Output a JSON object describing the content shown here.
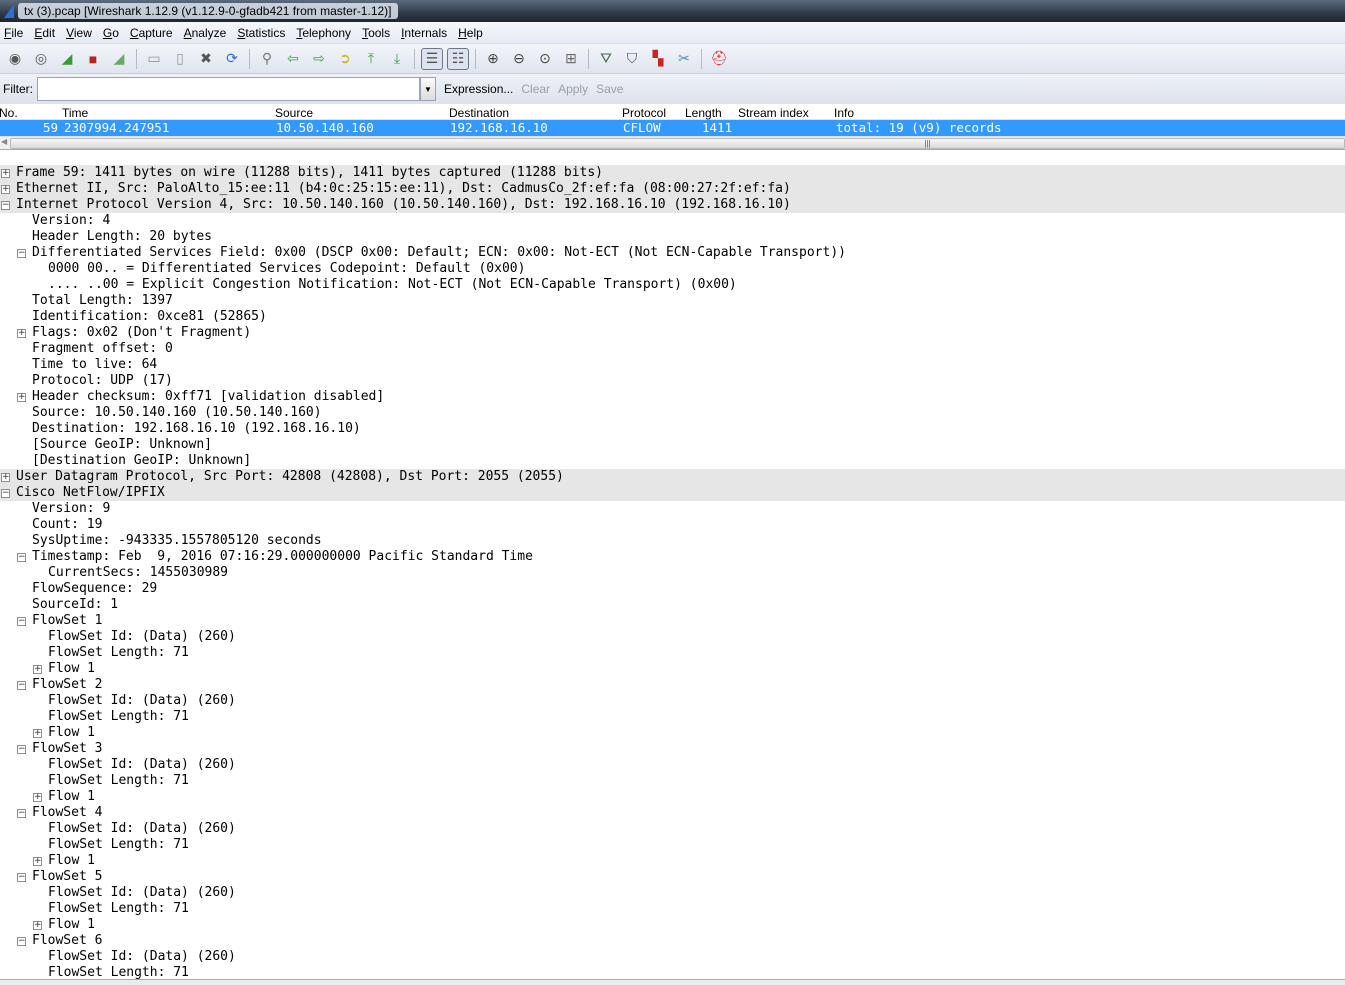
{
  "window": {
    "title": "tx (3).pcap   [Wireshark 1.12.9  (v1.12.9-0-gfadb421 from master-1.12)]"
  },
  "menu": [
    "File",
    "Edit",
    "View",
    "Go",
    "Capture",
    "Analyze",
    "Statistics",
    "Telephony",
    "Tools",
    "Internals",
    "Help"
  ],
  "toolbar": [
    {
      "name": "interfaces-icon",
      "g": "◉",
      "c": "#555"
    },
    {
      "name": "capture-options-icon",
      "g": "◎",
      "c": "#555"
    },
    {
      "name": "start-capture-icon",
      "g": "◢",
      "c": "#3a9a3a"
    },
    {
      "name": "stop-capture-icon",
      "g": "■",
      "c": "#b22"
    },
    {
      "name": "restart-capture-icon",
      "g": "◢",
      "c": "#6a6"
    },
    {
      "sep": true
    },
    {
      "name": "open-file-icon",
      "g": "▭",
      "c": "#997"
    },
    {
      "name": "save-file-icon",
      "g": "▯",
      "c": "#999"
    },
    {
      "name": "close-file-icon",
      "g": "✖",
      "c": "#555"
    },
    {
      "name": "reload-icon",
      "g": "⟳",
      "c": "#2a6fd6"
    },
    {
      "sep": true
    },
    {
      "name": "find-packet-icon",
      "g": "⚲",
      "c": "#777"
    },
    {
      "name": "go-back-icon",
      "g": "⇦",
      "c": "#3a3"
    },
    {
      "name": "go-forward-icon",
      "g": "⇨",
      "c": "#3a3"
    },
    {
      "name": "go-to-packet-icon",
      "g": "➲",
      "c": "#cb2"
    },
    {
      "name": "first-packet-icon",
      "g": "⤒",
      "c": "#3a3"
    },
    {
      "name": "last-packet-icon",
      "g": "⤓",
      "c": "#3a3"
    },
    {
      "sep": true
    },
    {
      "name": "colorize-icon",
      "g": "☰",
      "c": "#555",
      "p": true
    },
    {
      "name": "auto-scroll-icon",
      "g": "☷",
      "c": "#555",
      "p": true
    },
    {
      "sep": true
    },
    {
      "name": "zoom-in-icon",
      "g": "⊕",
      "c": "#444"
    },
    {
      "name": "zoom-out-icon",
      "g": "⊖",
      "c": "#444"
    },
    {
      "name": "zoom-normal-icon",
      "g": "⊙",
      "c": "#444"
    },
    {
      "name": "resize-columns-icon",
      "g": "⊞",
      "c": "#666"
    },
    {
      "sep": true
    },
    {
      "name": "capture-filters-icon",
      "g": "⛛",
      "c": "#464"
    },
    {
      "name": "display-filters-icon",
      "g": "⛉",
      "c": "#555"
    },
    {
      "name": "coloring-rules-icon",
      "g": "▚",
      "c": "#c22"
    },
    {
      "name": "preferences-icon",
      "g": "✂",
      "c": "#58a"
    },
    {
      "sep": true
    },
    {
      "name": "help-icon",
      "g": "⛑",
      "c": "#d33"
    }
  ],
  "filter": {
    "label": "Filter:",
    "value": "",
    "expression": "Expression...",
    "clear": "Clear",
    "apply": "Apply",
    "save": "Save"
  },
  "packet_list": {
    "columns": [
      "No.",
      "Time",
      "Source",
      "Destination",
      "Protocol",
      "Length",
      "Stream index",
      "Info"
    ],
    "rows": [
      {
        "no": "59",
        "time": "2307994.247951",
        "source": "10.50.140.160",
        "destination": "192.168.16.10",
        "protocol": "CFLOW",
        "length": "1411",
        "stream_index": "",
        "info": "total: 19 (v9) records"
      }
    ]
  },
  "details": [
    {
      "l": 0,
      "t": "+",
      "top": true,
      "s": "Frame 59: 1411 bytes on wire (11288 bits), 1411 bytes captured (11288 bits)"
    },
    {
      "l": 0,
      "t": "+",
      "top": true,
      "s": "Ethernet II, Src: PaloAlto_15:ee:11 (b4:0c:25:15:ee:11), Dst: CadmusCo_2f:ef:fa (08:00:27:2f:ef:fa)"
    },
    {
      "l": 0,
      "t": "-",
      "top": true,
      "s": "Internet Protocol Version 4, Src: 10.50.140.160 (10.50.140.160), Dst: 192.168.16.10 (192.168.16.10)"
    },
    {
      "l": 1,
      "s": "Version: 4"
    },
    {
      "l": 1,
      "s": "Header Length: 20 bytes"
    },
    {
      "l": 1,
      "t": "-",
      "s": "Differentiated Services Field: 0x00 (DSCP 0x00: Default; ECN: 0x00: Not-ECT (Not ECN-Capable Transport))"
    },
    {
      "l": 2,
      "s": "0000 00.. = Differentiated Services Codepoint: Default (0x00)"
    },
    {
      "l": 2,
      "s": ".... ..00 = Explicit Congestion Notification: Not-ECT (Not ECN-Capable Transport) (0x00)"
    },
    {
      "l": 1,
      "s": "Total Length: 1397"
    },
    {
      "l": 1,
      "s": "Identification: 0xce81 (52865)"
    },
    {
      "l": 1,
      "t": "+",
      "s": "Flags: 0x02 (Don't Fragment)"
    },
    {
      "l": 1,
      "s": "Fragment offset: 0"
    },
    {
      "l": 1,
      "s": "Time to live: 64"
    },
    {
      "l": 1,
      "s": "Protocol: UDP (17)"
    },
    {
      "l": 1,
      "t": "+",
      "s": "Header checksum: 0xff71 [validation disabled]"
    },
    {
      "l": 1,
      "s": "Source: 10.50.140.160 (10.50.140.160)"
    },
    {
      "l": 1,
      "s": "Destination: 192.168.16.10 (192.168.16.10)"
    },
    {
      "l": 1,
      "s": "[Source GeoIP: Unknown]"
    },
    {
      "l": 1,
      "s": "[Destination GeoIP: Unknown]"
    },
    {
      "l": 0,
      "t": "+",
      "top": true,
      "s": "User Datagram Protocol, Src Port: 42808 (42808), Dst Port: 2055 (2055)"
    },
    {
      "l": 0,
      "t": "-",
      "top": true,
      "s": "Cisco NetFlow/IPFIX"
    },
    {
      "l": 1,
      "s": "Version: 9"
    },
    {
      "l": 1,
      "s": "Count: 19"
    },
    {
      "l": 1,
      "s": "SysUptime: -943335.1557805120 seconds"
    },
    {
      "l": 1,
      "t": "-",
      "s": "Timestamp: Feb  9, 2016 07:16:29.000000000 Pacific Standard Time"
    },
    {
      "l": 2,
      "s": "CurrentSecs: 1455030989"
    },
    {
      "l": 1,
      "s": "FlowSequence: 29"
    },
    {
      "l": 1,
      "s": "SourceId: 1"
    },
    {
      "l": 1,
      "t": "-",
      "s": "FlowSet 1"
    },
    {
      "l": 2,
      "s": "FlowSet Id: (Data) (260)"
    },
    {
      "l": 2,
      "s": "FlowSet Length: 71"
    },
    {
      "l": 2,
      "t": "+",
      "s": "Flow 1"
    },
    {
      "l": 1,
      "t": "-",
      "s": "FlowSet 2"
    },
    {
      "l": 2,
      "s": "FlowSet Id: (Data) (260)"
    },
    {
      "l": 2,
      "s": "FlowSet Length: 71"
    },
    {
      "l": 2,
      "t": "+",
      "s": "Flow 1"
    },
    {
      "l": 1,
      "t": "-",
      "s": "FlowSet 3"
    },
    {
      "l": 2,
      "s": "FlowSet Id: (Data) (260)"
    },
    {
      "l": 2,
      "s": "FlowSet Length: 71"
    },
    {
      "l": 2,
      "t": "+",
      "s": "Flow 1"
    },
    {
      "l": 1,
      "t": "-",
      "s": "FlowSet 4"
    },
    {
      "l": 2,
      "s": "FlowSet Id: (Data) (260)"
    },
    {
      "l": 2,
      "s": "FlowSet Length: 71"
    },
    {
      "l": 2,
      "t": "+",
      "s": "Flow 1"
    },
    {
      "l": 1,
      "t": "-",
      "s": "FlowSet 5"
    },
    {
      "l": 2,
      "s": "FlowSet Id: (Data) (260)"
    },
    {
      "l": 2,
      "s": "FlowSet Length: 71"
    },
    {
      "l": 2,
      "t": "+",
      "s": "Flow 1"
    },
    {
      "l": 1,
      "t": "-",
      "s": "FlowSet 6"
    },
    {
      "l": 2,
      "s": "FlowSet Id: (Data) (260)"
    },
    {
      "l": 2,
      "s": "FlowSet Length: 71"
    }
  ],
  "colors": {
    "selection": "#3399ff",
    "header_row": "#e6e6e6"
  }
}
